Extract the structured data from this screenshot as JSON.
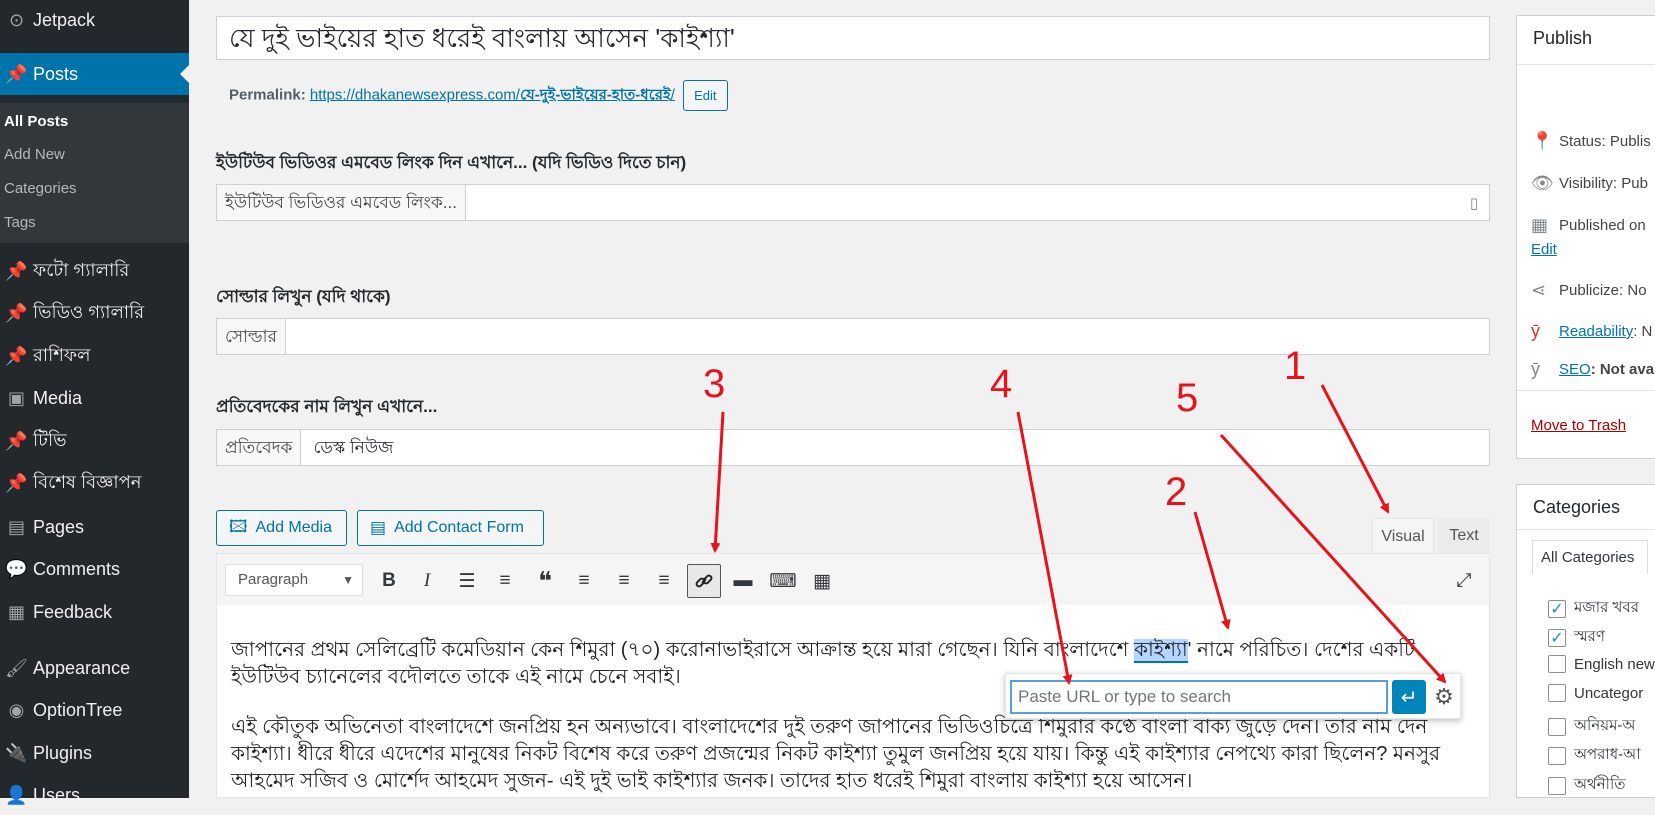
{
  "sidebar": {
    "jetpack": "Jetpack",
    "posts": "Posts",
    "submenu": [
      "All Posts",
      "Add New",
      "Categories",
      "Tags"
    ],
    "items": [
      "ফটো গ্যালারি",
      "ভিডিও গ্যালারি",
      "রাশিফল",
      "Media",
      "টিভি",
      "বিশেষ বিজ্ঞাপন",
      "Pages",
      "Comments",
      "Feedback",
      "Appearance",
      "OptionTree",
      "Plugins",
      "Users"
    ]
  },
  "post": {
    "title": "যে দুই ভাইয়ের হাত ধরেই বাংলায় আসেন 'কাইশ্যা'",
    "permalink_label": "Permalink:",
    "permalink_base": "https://dhakanewsexpress.com/",
    "permalink_slug": "যে-দুই-ভাইয়ের-হাত-ধরেই",
    "permalink_end": "/",
    "permalink_edit": "Edit"
  },
  "fields": {
    "youtube_label": "ইউটিউব ভিডিওর এমবেড লিংক দিন এখানে... (যদি ভিডিও দিতে চান)",
    "youtube_prefix": "ইউটিউব ভিডিওর এমবেড লিংক...",
    "source_label": "সোল্ডার লিখুন (যদি থাকে)",
    "source_prefix": "সোল্ডার",
    "reporter_label": "প্রতিবেদকের নাম লিখুন এখানে...",
    "reporter_prefix": "প্রতিবেদক",
    "reporter_value": "ডেস্ক নিউজ"
  },
  "editor": {
    "add_media": "Add Media",
    "add_contact_form": "Add Contact Form",
    "tab_visual": "Visual",
    "tab_text": "Text",
    "format": "Paragraph",
    "para1_before": "জাপানের প্রথম সেলিব্রেটি কমেডিয়ান কেন শিমুরা (৭০) করোনাভাইরাসে আক্রান্ত হয়ে মারা গেছেন। যিনি বাংলাদেশে ",
    "para1_highlight": "কাইশ্যা",
    "para1_after": "' নামে পরিচিত। দেশের একটি ইউটিউব চ্যানেলের বদৌলতে তাকে এই নামে চেনে সবাই।",
    "para2": "এই কৌতুক অভিনেতা বাংলাদেশে জনপ্রিয় হন অন্যভাবে। বাংলাদেশের দুই তরুণ জাপানের ভিডিওচিত্রে শিমুরার কণ্ঠে বাংলা বাক্য জুড়ে দেন। তার নাম দেন কাইশ্যা। ধীরে ধীরে এদেশের মানুষের নিকট বিশেষ করে তরুণ প্রজন্মের নিকট কাইশ্যা তুমুল জনপ্রিয় হয়ে যায়। কিন্তু এই কাইশ্যার নেপথ্যে কারা ছিলেন? মনসুর আহমেদ সজিব ও মোর্শেদ আহমেদ সুজন- এই দুই ভাই কাইশ্যার জনক। তাদের হাত ধরেই শিমুরা বাংলায় কাইশ্যা হয়ে আসেন।",
    "link_placeholder": "Paste URL or type to search"
  },
  "publish": {
    "title": "Publish",
    "status": "Status: Publis",
    "visibility": "Visibility: Pub",
    "published_on": "Published on",
    "edit": "Edit",
    "publicize": "Publicize: No",
    "readability_link": "Readability",
    "readability_rest": ": N",
    "seo_link": "SEO",
    "seo_rest": ": Not ava",
    "trash": "Move to Trash"
  },
  "categories": {
    "title": "Categories",
    "tab": "All Categories",
    "items": [
      {
        "label": "মজার খবর",
        "checked": true
      },
      {
        "label": "স্মরণ",
        "checked": true
      },
      {
        "label": "English new",
        "checked": false
      },
      {
        "label": "Uncategor",
        "checked": false
      },
      {
        "label": "অনিয়ম-অ",
        "checked": false
      },
      {
        "label": "অপরাধ-আ",
        "checked": false
      },
      {
        "label": "অর্থনীতি",
        "checked": false
      }
    ]
  },
  "annotations": [
    "1",
    "2",
    "3",
    "4",
    "5"
  ],
  "colors": {
    "accent": "#0073aa",
    "annotation": "#e8131a",
    "sidebar": "#23282d"
  }
}
